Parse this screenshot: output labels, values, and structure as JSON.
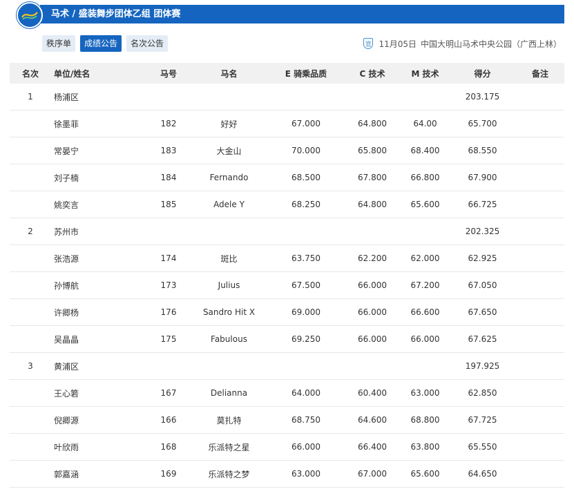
{
  "header": {
    "title": "马术 / 盛装舞步团体乙组  团体赛"
  },
  "tabs": [
    {
      "label": "秩序单",
      "active": false
    },
    {
      "label": "成绩公告",
      "active": true
    },
    {
      "label": "名次公告",
      "active": false
    }
  ],
  "event": {
    "badge": "官",
    "date": "11月05日",
    "venue": "中国大明山马术中央公园（广西上林）"
  },
  "colors": {
    "primary": "#1565c0",
    "tab_bg": "#e4edf6",
    "header_bg": "#f1f1f1"
  },
  "table": {
    "columns": [
      "名次",
      "单位/姓名",
      "马号",
      "马名",
      "E 骑乘品质",
      "C 技术",
      "M 技术",
      "得分",
      "备注"
    ],
    "teams": [
      {
        "rank": "1",
        "name": "杨浦区",
        "score": "203.175",
        "riders": [
          {
            "name": "徐墨菲",
            "horse_no": "182",
            "horse": "好好",
            "e": "67.000",
            "c": "64.800",
            "m": "64.00",
            "score": "65.700"
          },
          {
            "name": "常晏宁",
            "horse_no": "183",
            "horse": "大金山",
            "e": "70.000",
            "c": "65.800",
            "m": "68.400",
            "score": "68.550"
          },
          {
            "name": "刘子楠",
            "horse_no": "184",
            "horse": "Fernando",
            "e": "68.500",
            "c": "67.800",
            "m": "66.800",
            "score": "67.900"
          },
          {
            "name": "姚奕言",
            "horse_no": "185",
            "horse": "Adele Y",
            "e": "68.250",
            "c": "64.800",
            "m": "65.600",
            "score": "66.725"
          }
        ]
      },
      {
        "rank": "2",
        "name": "苏州市",
        "score": "202.325",
        "riders": [
          {
            "name": "张浩源",
            "horse_no": "174",
            "horse": "斑比",
            "e": "63.750",
            "c": "62.200",
            "m": "62.000",
            "score": "62.925"
          },
          {
            "name": "孙博航",
            "horse_no": "173",
            "horse": "Julius",
            "e": "67.500",
            "c": "66.000",
            "m": "67.200",
            "score": "67.050"
          },
          {
            "name": "许卿杨",
            "horse_no": "176",
            "horse": "Sandro Hit X",
            "e": "69.000",
            "c": "66.000",
            "m": "66.600",
            "score": "67.650"
          },
          {
            "name": "吴晶晶",
            "horse_no": "175",
            "horse": "Fabulous",
            "e": "69.250",
            "c": "66.000",
            "m": "66.000",
            "score": "67.625"
          }
        ]
      },
      {
        "rank": "3",
        "name": "黄浦区",
        "score": "197.925",
        "riders": [
          {
            "name": "王心箬",
            "horse_no": "167",
            "horse": "Delianna",
            "e": "64.000",
            "c": "60.400",
            "m": "63.000",
            "score": "62.850"
          },
          {
            "name": "倪卿源",
            "horse_no": "166",
            "horse": "莫扎特",
            "e": "68.750",
            "c": "64.600",
            "m": "68.800",
            "score": "67.725"
          },
          {
            "name": "叶欣雨",
            "horse_no": "168",
            "horse": "乐派特之星",
            "e": "66.000",
            "c": "66.400",
            "m": "63.800",
            "score": "65.550"
          },
          {
            "name": "郭嘉涵",
            "horse_no": "169",
            "horse": "乐派特之梦",
            "e": "63.000",
            "c": "67.000",
            "m": "65.600",
            "score": "64.650"
          }
        ]
      }
    ]
  }
}
